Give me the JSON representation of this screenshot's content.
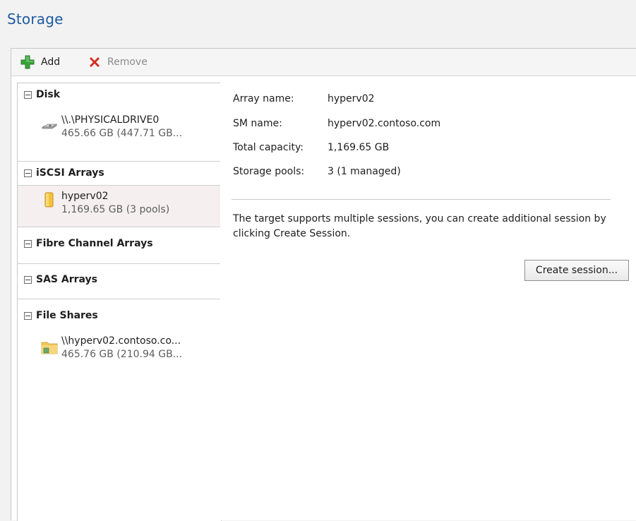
{
  "page": {
    "title": "Storage"
  },
  "toolbar": {
    "add_label": "Add",
    "remove_label": "Remove",
    "add_icon": "add-green-plus-icon",
    "remove_icon": "remove-red-x-icon"
  },
  "tree": {
    "groups": [
      {
        "label": "Disk",
        "items": [
          {
            "name": "\\\\.\\PHYSICALDRIVE0",
            "detail": "465.66 GB (447.71 GB...",
            "icon": "disk-drive-icon"
          }
        ]
      },
      {
        "label": "iSCSI Arrays",
        "items": [
          {
            "name": "hyperv02",
            "detail": "1,169.65 GB (3 pools)",
            "icon": "storage-array-icon",
            "selected": true
          }
        ]
      },
      {
        "label": "Fibre Channel Arrays",
        "items": []
      },
      {
        "label": "SAS Arrays",
        "items": []
      },
      {
        "label": "File Shares",
        "items": [
          {
            "name": "\\\\hyperv02.contoso.co...",
            "detail": "465.76 GB (210.94 GB...",
            "icon": "file-share-icon"
          }
        ]
      }
    ]
  },
  "details": {
    "array_name_label": "Array name:",
    "array_name_value": "hyperv02",
    "sm_name_label": "SM name:",
    "sm_name_value": "hyperv02.contoso.com",
    "total_capacity_label": "Total capacity:",
    "total_capacity_value": "1,169.65 GB",
    "storage_pools_label": "Storage pools:",
    "storage_pools_value": "3 (1 managed)",
    "description": "The target supports multiple sessions, you can create additional session by clicking Create Session.",
    "create_session_label": "Create session..."
  },
  "colors": {
    "title": "#1e5aa0",
    "selected_row": "#f5eff0",
    "add_icon": "#3aa33a",
    "remove_icon": "#d42a1c"
  }
}
